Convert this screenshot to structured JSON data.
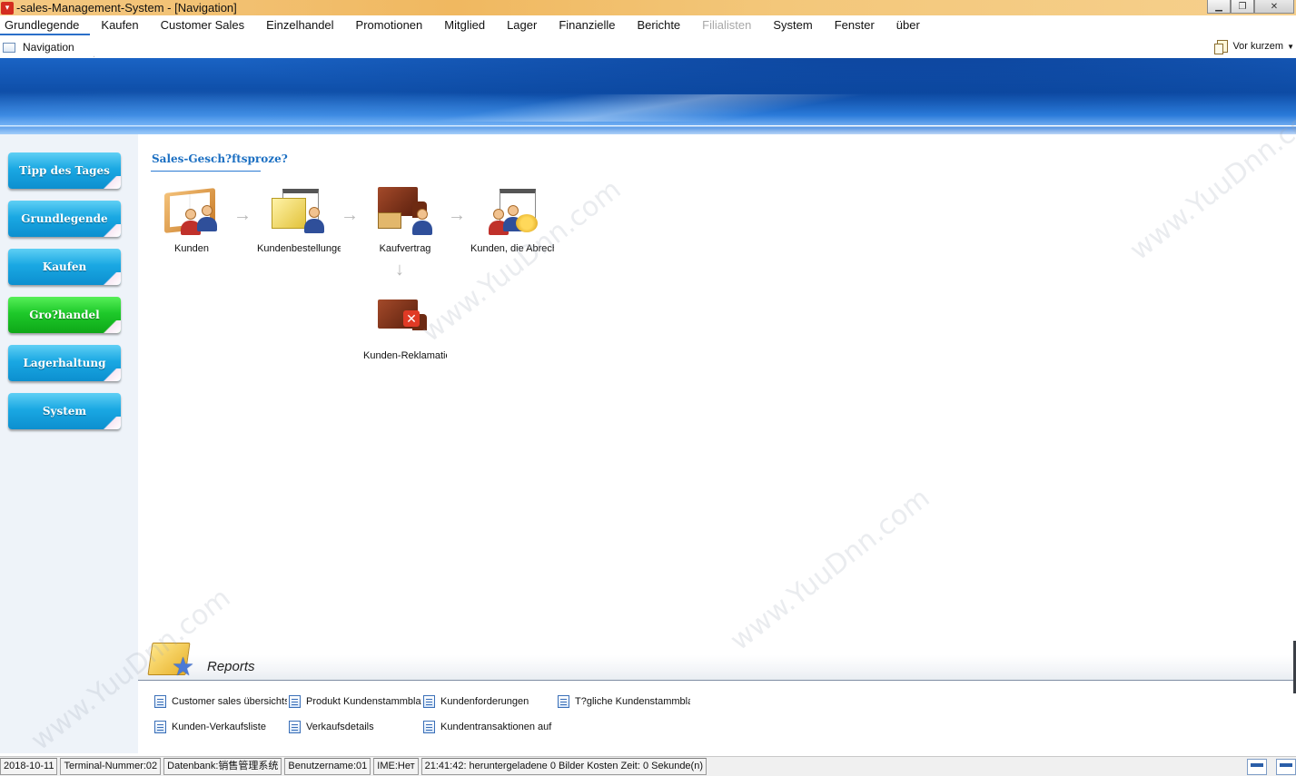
{
  "window": {
    "title": "-sales-Management-System - [Navigation]"
  },
  "menu": {
    "items": [
      "Grundlegende",
      "Kaufen",
      "Customer Sales",
      "Einzelhandel",
      "Promotionen",
      "Mitglied",
      "Lager",
      "Finanzielle",
      "Berichte",
      "Filialisten",
      "System",
      "Fenster",
      "über"
    ],
    "disabled_item": "Filialisten"
  },
  "tabs": {
    "navigation": "Navigation",
    "recent": "Vor kurzem"
  },
  "sidebar": {
    "buttons": [
      "Tipp des Tages",
      "Grundlegende",
      "Kaufen",
      "Gro?handel",
      "Lagerhaltung",
      "System"
    ],
    "active_button": "Gro?handel",
    "colors": {
      "default": "#1aa8e3",
      "active": "#1ec92a"
    }
  },
  "process": {
    "title": "Sales-Gesch?ftsproze?",
    "nodes": {
      "kunden": "Kunden",
      "bestellungen": "Kundenbestellungen",
      "kaufvertrag": "Kaufvertrag",
      "abrechnung": "Kunden, die Abrechnung",
      "reklamation": "Kunden-Reklamation"
    }
  },
  "reports": {
    "title": "Reports",
    "links": [
      "Customer sales übersichts",
      "Produkt Kundenstammblatt",
      "Kundenforderungen",
      "T?gliche Kundenstammblatt",
      "Kunden-Verkaufsliste",
      "Verkaufsdetails",
      "Kundentransaktionen auf"
    ]
  },
  "status": {
    "date": "2018-10-11",
    "terminal": "Terminal-Nummer:02",
    "database": "Datenbank:销售管理系统",
    "user": "Benutzername:01",
    "ime": "IME:Нет",
    "message": "21:41:42: heruntergeladene 0 Bilder Kosten Zeit: 0 Sekunde(n)"
  },
  "watermark": "www.YuuDnn.com",
  "theme": {
    "accent": "#1b6fc2",
    "banner": "#0e4ea8",
    "titlebar": "#f0b860"
  }
}
